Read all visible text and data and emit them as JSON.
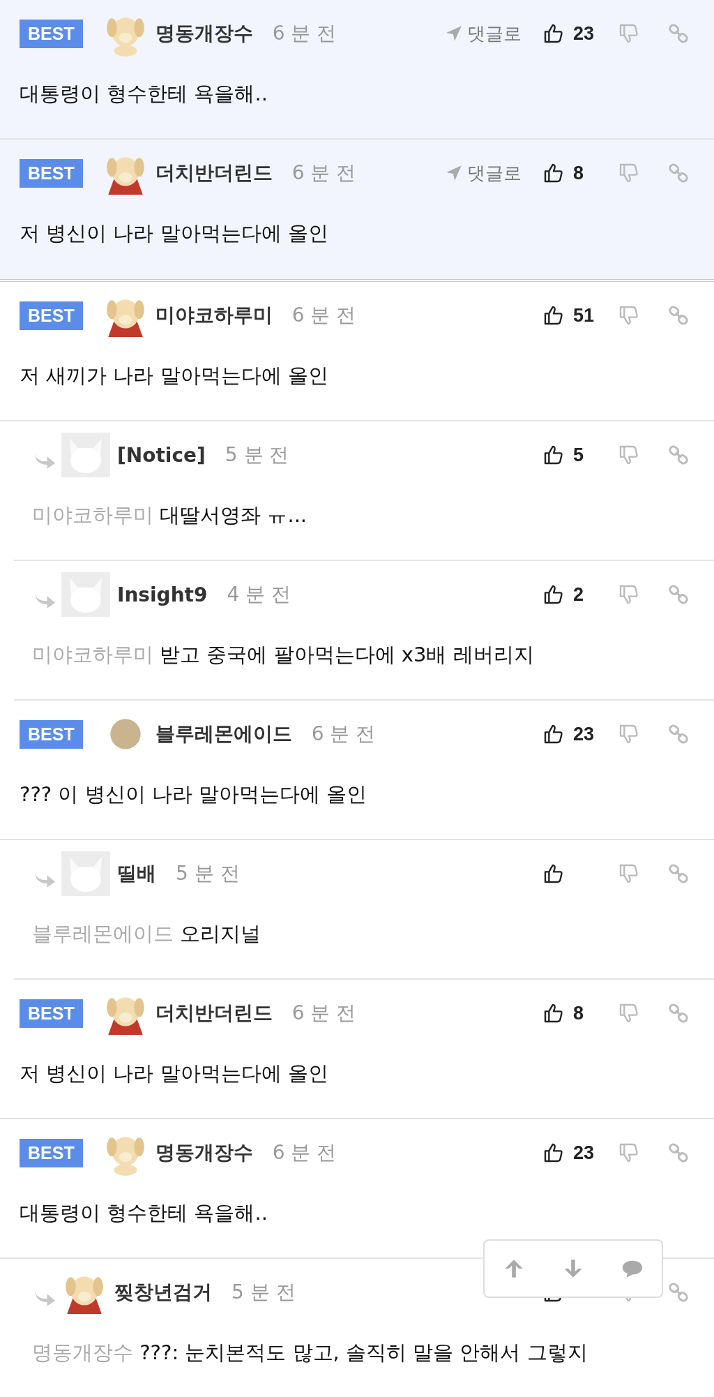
{
  "pinned_best": [
    {
      "kind": "comment",
      "badge": "BEST",
      "avatar": {
        "kind": "puppy"
      },
      "author": "명동개장수",
      "time": "6 분 전",
      "goto": "댓글로",
      "likes": "23",
      "text": "대통령이 형수한테 욕을해.."
    },
    {
      "kind": "comment",
      "badge": "BEST",
      "avatar": {
        "kind": "puppy-cape"
      },
      "author": "더치반더린드",
      "time": "6 분 전",
      "goto": "댓글로",
      "likes": "8",
      "text": "저 병신이 나라 말아먹는다에 올인"
    }
  ],
  "comments": [
    {
      "kind": "comment",
      "badge": "BEST",
      "avatar": {
        "kind": "puppy-cape"
      },
      "author": "미야코하루미",
      "time": "6 분 전",
      "likes": "51",
      "text": "저 새끼가 나라 말아먹는다에 올인"
    },
    {
      "kind": "reply",
      "avatar": {
        "kind": "fox"
      },
      "author": "[Notice]",
      "time": "5 분 전",
      "likes": "5",
      "mention": "미야코하루미",
      "text": "대딸서영좌 ㅠ..."
    },
    {
      "kind": "reply",
      "avatar": {
        "kind": "fox"
      },
      "author": "Insight9",
      "time": "4 분 전",
      "likes": "2",
      "mention": "미야코하루미",
      "text": "받고 중국에 팔아먹는다에 x3배 레버리지"
    },
    {
      "kind": "comment",
      "badge": "BEST",
      "avatar": {
        "kind": "circle"
      },
      "author": "블루레몬에이드",
      "time": "6 분 전",
      "likes": "23",
      "text": "??? 이 병신이 나라 말아먹는다에 올인"
    },
    {
      "kind": "reply",
      "avatar": {
        "kind": "fox"
      },
      "author": "띨배",
      "time": "5 분 전",
      "mention": "블루레몬에이드",
      "text": "오리지널"
    },
    {
      "kind": "comment",
      "badge": "BEST",
      "avatar": {
        "kind": "puppy-cape"
      },
      "author": "더치반더린드",
      "time": "6 분 전",
      "likes": "8",
      "text": "저 병신이 나라 말아먹는다에 올인"
    },
    {
      "kind": "comment",
      "badge": "BEST",
      "avatar": {
        "kind": "puppy"
      },
      "author": "명동개장수",
      "time": "6 분 전",
      "likes": "23",
      "text": "대통령이 형수한테 욕을해.."
    },
    {
      "kind": "reply",
      "avatar": {
        "kind": "puppy-cape"
      },
      "author": "찢창년검거",
      "time": "5 분 전",
      "mention": "명동개장수",
      "text": "???: 눈치본적도 많고, 솔직히 말을 안해서 그렇지"
    }
  ]
}
